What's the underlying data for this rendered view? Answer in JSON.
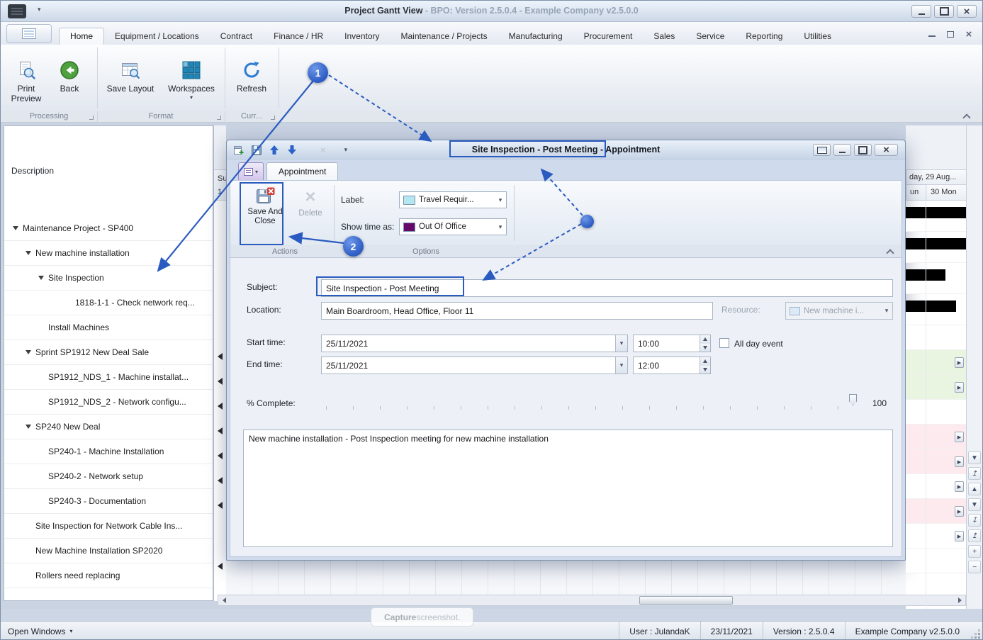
{
  "titlebar": {
    "title_bold": "Project Gantt View",
    "title_rest": " - BPO: Version 2.5.0.4 - Example Company v2.5.0.0"
  },
  "ribbon": {
    "tabs": [
      {
        "label": "Home",
        "active": "true"
      },
      {
        "label": "Equipment / Locations"
      },
      {
        "label": "Contract"
      },
      {
        "label": "Finance / HR"
      },
      {
        "label": "Inventory"
      },
      {
        "label": "Maintenance / Projects"
      },
      {
        "label": "Manufacturing"
      },
      {
        "label": "Procurement"
      },
      {
        "label": "Sales"
      },
      {
        "label": "Service"
      },
      {
        "label": "Reporting"
      },
      {
        "label": "Utilities"
      }
    ],
    "buttons": {
      "print_preview": "Print Preview",
      "back": "Back",
      "save_layout": "Save Layout",
      "workspaces": "Workspaces",
      "refresh": "Refresh"
    },
    "groups": {
      "processing": "Processing",
      "format": "Format",
      "current": "Curr..."
    }
  },
  "tree": {
    "header": "Description",
    "items": [
      {
        "label": "Maintenance Project - SP400",
        "level": "0",
        "expander": "true"
      },
      {
        "label": "New machine installation",
        "level": "1",
        "expander": "true"
      },
      {
        "label": "Site Inspection",
        "level": "2",
        "expander": "true"
      },
      {
        "label": "1818-1-1 - Check network req...",
        "level": "3"
      },
      {
        "label": "Install Machines",
        "level": "2"
      },
      {
        "label": "Sprint SP1912 New Deal Sale",
        "level": "1",
        "expander": "true"
      },
      {
        "label": "SP1912_NDS_1 - Machine installat...",
        "level": "2"
      },
      {
        "label": "SP1912_NDS_2 - Network configu...",
        "level": "2"
      },
      {
        "label": "SP240 New Deal",
        "level": "1",
        "expander": "true"
      },
      {
        "label": "SP240-1 - Machine Installation",
        "level": "2"
      },
      {
        "label": "SP240-2 - Network setup",
        "level": "2"
      },
      {
        "label": "SP240-3 - Documentation",
        "level": "2"
      },
      {
        "label": "Site Inspection for Network Cable Ins...",
        "level": "1"
      },
      {
        "label": "New Machine Installation SP2020",
        "level": "1"
      },
      {
        "label": "Rollers need replacing",
        "level": "1"
      }
    ]
  },
  "gantt": {
    "partial_header_top": "Su",
    "partial_header_bottom": "1",
    "date_header": "day, 29 Aug...",
    "col_sun": "un",
    "col_mon": "30 Mon",
    "rows": [
      {
        "bg": "#ffffff",
        "bar": "true",
        "barw": "100%"
      },
      {
        "bg": "#ffffff",
        "bar": "true",
        "barw": "100%"
      },
      {
        "bg": "#ffffff",
        "bar": "true",
        "barw": "66%"
      },
      {
        "bg": "#ffffff",
        "bar": "true",
        "barw": "84%"
      },
      {
        "bg": "#ffffff"
      },
      {
        "bg": "#e9f4e1",
        "arrow": "true"
      },
      {
        "bg": "#e9f4e1",
        "arrow": "true"
      },
      {
        "bg": "#ffffff"
      },
      {
        "bg": "#fdeaee",
        "arrow": "true"
      },
      {
        "bg": "#fdeaee",
        "arrow": "true"
      },
      {
        "bg": "#ffffff",
        "arrow": "true"
      },
      {
        "bg": "#fdeaee",
        "arrow": "true"
      },
      {
        "bg": "#ffffff",
        "arrow": "true"
      },
      {
        "bg": "#ffffff"
      }
    ],
    "side_tools": [
      {
        "name": "scroll-down-icon",
        "glyph": "▼"
      },
      {
        "name": "jump-top-icon",
        "glyph": "↥"
      },
      {
        "name": "scroll-up-icon",
        "glyph": "▲"
      },
      {
        "name": "scroll-down-icon",
        "glyph": "▼"
      },
      {
        "name": "jump-bottom-icon",
        "glyph": "↧"
      },
      {
        "name": "jump-top-icon",
        "glyph": "↥"
      },
      {
        "name": "zoom-in-icon",
        "glyph": "+"
      },
      {
        "name": "zoom-out-icon",
        "glyph": "−"
      }
    ]
  },
  "dialog": {
    "title_highlight": "Site Inspection - Post Meeting",
    "title_suffix": " - Appointment",
    "tab_appointment": "Appointment",
    "btn_save_close": "Save And Close",
    "btn_delete": "Delete",
    "lbl_label": "Label:",
    "label_value": "Travel Requir...",
    "lbl_show_time": "Show time as:",
    "show_time_value": "Out Of Office",
    "group_actions": "Actions",
    "group_options": "Options",
    "lbl_subject": "Subject:",
    "subject_value": "Site Inspection - Post Meeting",
    "lbl_location": "Location:",
    "location_value": "Main Boardroom, Head Office, Floor 11",
    "lbl_resource": "Resource:",
    "resource_value": "New machine i...",
    "lbl_start": "Start time:",
    "start_date": "25/11/2021",
    "start_time": "10:00",
    "lbl_end": "End time:",
    "end_date": "25/11/2021",
    "end_time": "12:00",
    "chk_all_day": "All day event",
    "lbl_percent": "% Complete:",
    "percent_value": "100",
    "notes": "New machine installation - Post Inspection meeting for new machine installation"
  },
  "statusbar": {
    "open_windows": "Open Windows",
    "user": "User : JulandaK",
    "date": "23/11/2021",
    "version": "Version : 2.5.0.4",
    "company": "Example Company v2.5.0.0"
  },
  "capture_tip": {
    "bold": "Capture",
    "rest": " screenshot."
  },
  "annotations": {
    "step1": "1",
    "step2": "2"
  },
  "colors": {
    "annotation_blue": "#2a5bc0",
    "highlight_border": "#2a5bbf",
    "label_swatch": "#b5e6f2",
    "show_time_swatch": "#650a69",
    "resource_swatch": "#dce9f6",
    "gantt_bar": "#000000",
    "back_green": "#4fa03e",
    "icon_blue": "#2d7cd4"
  }
}
